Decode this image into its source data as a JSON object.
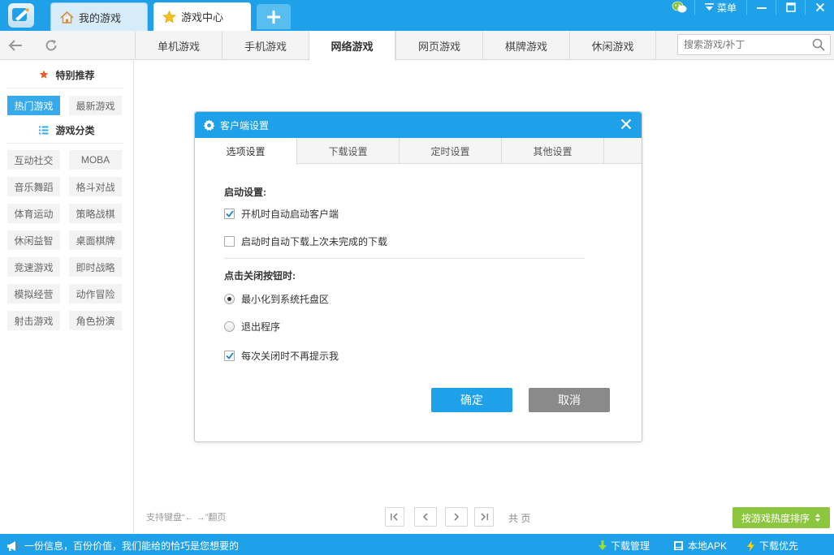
{
  "tabs": {
    "my_games": "我的游戏",
    "game_center": "游戏中心",
    "add": "+"
  },
  "window": {
    "menu_label": "菜单"
  },
  "nav": {
    "categories": [
      "单机游戏",
      "手机游戏",
      "网络游戏",
      "网页游戏",
      "棋牌游戏",
      "休闲游戏"
    ],
    "active_index": 2,
    "search_placeholder": "搜索游戏/补丁"
  },
  "sidebar": {
    "recommend_title": "特别推荐",
    "recommend_items": [
      "热门游戏",
      "最新游戏"
    ],
    "category_title": "游戏分类",
    "category_items": [
      "互动社交",
      "MOBA",
      "音乐舞蹈",
      "格斗对战",
      "体育运动",
      "策略战棋",
      "休闲益智",
      "桌面棋牌",
      "竞速游戏",
      "即时战略",
      "模拟经营",
      "动作冒险",
      "射击游戏",
      "角色扮演"
    ]
  },
  "main": {
    "keyboard_hint": "支持键盘“← →”翻页",
    "pager_total": "共  页",
    "sort_label": "按游戏热度排序"
  },
  "dialog": {
    "title": "客户端设置",
    "tabs": [
      "选项设置",
      "下载设置",
      "定时设置",
      "其他设置"
    ],
    "startup_heading": "启动设置:",
    "opt_autostart": "开机时自动启动客户端",
    "opt_resume_download": "启动时自动下载上次未完成的下载",
    "close_heading": "点击关闭按钮时:",
    "opt_minimize": "最小化到系统托盘区",
    "opt_exit": "退出程序",
    "opt_no_prompt": "每次关闭时不再提示我",
    "ok": "确定",
    "cancel": "取消"
  },
  "statusbar": {
    "message": "一份信息，百份价值，我们能给的恰巧是您想要的",
    "download_mgr": "下载管理",
    "local_apk": "本地APK",
    "download_priority": "下载优先"
  },
  "colors": {
    "accent": "#1ea1e8",
    "sort_green": "#8cc63f",
    "star_orange": "#f05a28",
    "cancel_gray": "#8a8a8a"
  }
}
